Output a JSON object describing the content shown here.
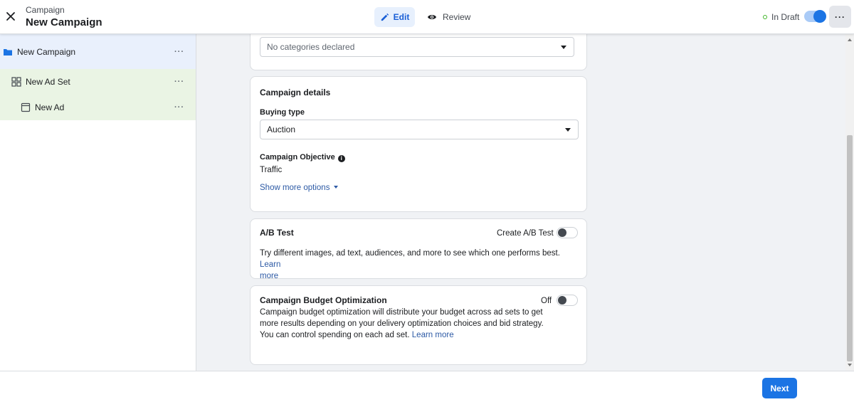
{
  "header": {
    "subtitle": "Campaign",
    "title": "New Campaign",
    "edit_label": "Edit",
    "review_label": "Review",
    "status_label": "In Draft",
    "more_label": "···"
  },
  "sidebar": {
    "items": [
      {
        "label": "New Campaign",
        "icon": "folder-icon",
        "more": "···"
      },
      {
        "label": "New Ad Set",
        "icon": "grid-icon",
        "more": "···"
      },
      {
        "label": "New Ad",
        "icon": "ad-icon",
        "more": "···"
      }
    ]
  },
  "categories": {
    "select_value": "No categories declared"
  },
  "campaign_details": {
    "title": "Campaign details",
    "buying_type_label": "Buying type",
    "buying_type_value": "Auction",
    "objective_label": "Campaign Objective",
    "objective_value": "Traffic",
    "show_more_label": "Show more options"
  },
  "ab_test": {
    "title": "A/B Test",
    "toggle_label": "Create A/B Test",
    "toggle_on": false,
    "description": "Try different images, ad text, audiences, and more to see which one performs best.",
    "learn_more_line1": "Learn",
    "learn_more_line2": "more"
  },
  "cbo": {
    "title": "Campaign Budget Optimization",
    "toggle_label": "Off",
    "toggle_on": false,
    "description_line1": "Campaign budget optimization will distribute your budget across ad sets to get",
    "description_line2": "more results depending on your delivery optimization choices and bid strategy.",
    "description_line3": "You can control spending on each ad set.",
    "learn_more": "Learn more"
  },
  "footer": {
    "next_label": "Next"
  },
  "colors": {
    "primary": "#1b74e4",
    "campaign_row_bg": "#e9f0fc",
    "adset_row_bg": "#eaf4e4",
    "draft_dot": "#42b72a",
    "link": "#2d5aa5"
  }
}
